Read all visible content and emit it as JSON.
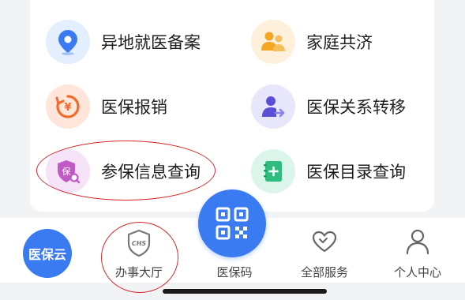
{
  "services": [
    {
      "label": "异地就医备案",
      "icon": "location-pin-icon"
    },
    {
      "label": "家庭共济",
      "icon": "family-people-icon"
    },
    {
      "label": "医保报销",
      "icon": "yuan-refresh-icon"
    },
    {
      "label": "医保关系转移",
      "icon": "person-transfer-icon"
    },
    {
      "label": "参保信息查询",
      "icon": "insurance-shield-search-icon"
    },
    {
      "label": "医保目录查询",
      "icon": "catalog-book-icon"
    }
  ],
  "tabbar": {
    "logo": "医保云",
    "tabs": [
      {
        "label": "办事大厅",
        "icon": "chs-shield-icon"
      },
      {
        "label": "医保码",
        "icon": "qr-code-icon"
      },
      {
        "label": "全部服务",
        "icon": "heart-icon"
      },
      {
        "label": "个人中心",
        "icon": "person-icon"
      }
    ],
    "chs_badge": "CHS",
    "shield_char": "保"
  },
  "colors": {
    "accent_blue": "#3a7bf2",
    "annotation_red": "#d8262a"
  }
}
